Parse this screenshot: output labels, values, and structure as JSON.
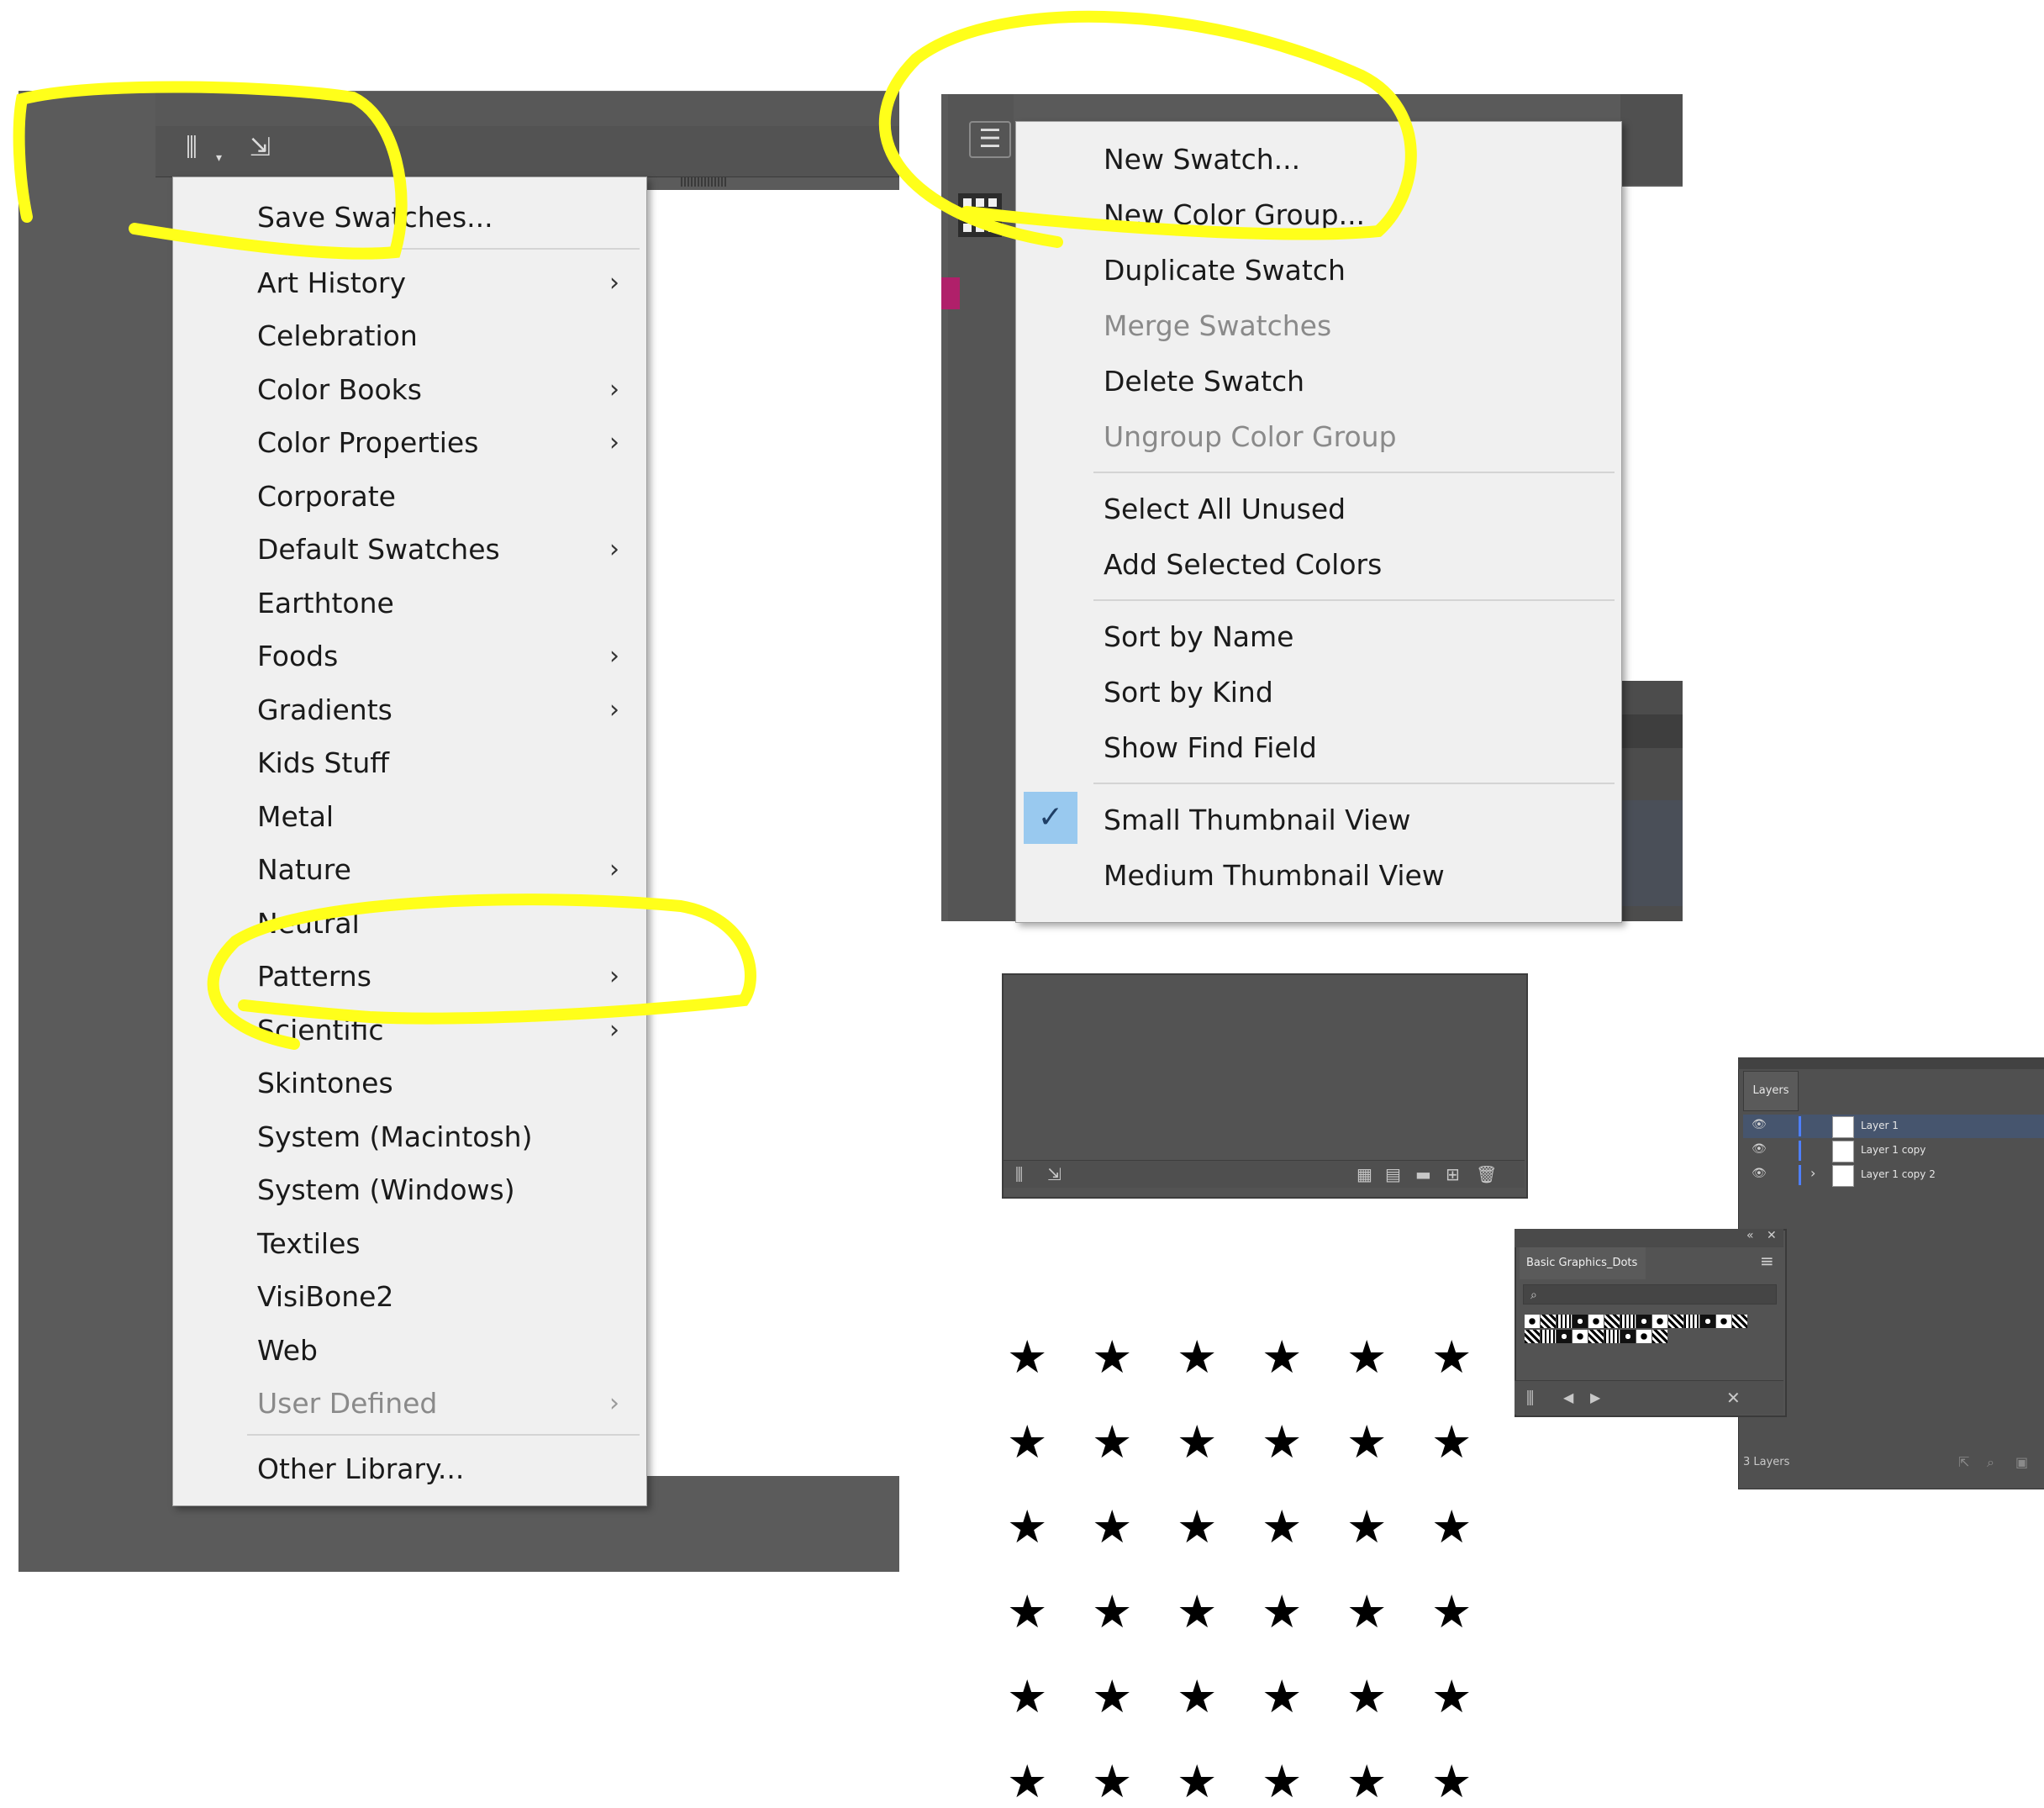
{
  "library_menu": {
    "items": [
      {
        "label": "Save Swatches...",
        "has_submenu": false,
        "disabled": false
      },
      {
        "label": "Art History",
        "has_submenu": true,
        "disabled": false
      },
      {
        "label": "Celebration",
        "has_submenu": false,
        "disabled": false
      },
      {
        "label": "Color Books",
        "has_submenu": true,
        "disabled": false
      },
      {
        "label": "Color Properties",
        "has_submenu": true,
        "disabled": false
      },
      {
        "label": "Corporate",
        "has_submenu": false,
        "disabled": false
      },
      {
        "label": "Default Swatches",
        "has_submenu": true,
        "disabled": false
      },
      {
        "label": "Earthtone",
        "has_submenu": false,
        "disabled": false
      },
      {
        "label": "Foods",
        "has_submenu": true,
        "disabled": false
      },
      {
        "label": "Gradients",
        "has_submenu": true,
        "disabled": false
      },
      {
        "label": "Kids Stuff",
        "has_submenu": false,
        "disabled": false
      },
      {
        "label": "Metal",
        "has_submenu": false,
        "disabled": false
      },
      {
        "label": "Nature",
        "has_submenu": true,
        "disabled": false
      },
      {
        "label": "Neutral",
        "has_submenu": false,
        "disabled": false
      },
      {
        "label": "Patterns",
        "has_submenu": true,
        "disabled": false
      },
      {
        "label": "Scientific",
        "has_submenu": true,
        "disabled": false
      },
      {
        "label": "Skintones",
        "has_submenu": false,
        "disabled": false
      },
      {
        "label": "System (Macintosh)",
        "has_submenu": false,
        "disabled": false
      },
      {
        "label": "System (Windows)",
        "has_submenu": false,
        "disabled": false
      },
      {
        "label": "Textiles",
        "has_submenu": false,
        "disabled": false
      },
      {
        "label": "VisiBone2",
        "has_submenu": false,
        "disabled": false
      },
      {
        "label": "Web",
        "has_submenu": false,
        "disabled": false
      },
      {
        "label": "User Defined",
        "has_submenu": true,
        "disabled": true
      },
      {
        "label": "Other Library...",
        "has_submenu": false,
        "disabled": false
      }
    ],
    "arrow_glyph": "›"
  },
  "panel_menu": {
    "items": [
      {
        "label": "New Swatch...",
        "disabled": false
      },
      {
        "label": "New Color Group...",
        "disabled": false
      },
      {
        "label": "Duplicate Swatch",
        "disabled": false
      },
      {
        "label": "Merge Swatches",
        "disabled": true
      },
      {
        "label": "Delete Swatch",
        "disabled": false
      },
      {
        "label": "Ungroup Color Group",
        "disabled": true
      },
      {
        "label": "Select All Unused",
        "disabled": false
      },
      {
        "label": "Add Selected Colors",
        "disabled": false
      },
      {
        "label": "Sort by Name",
        "disabled": false
      },
      {
        "label": "Sort by Kind",
        "disabled": false
      },
      {
        "label": "Show Find Field",
        "disabled": false
      },
      {
        "label": "Small Thumbnail View",
        "disabled": false,
        "checked": true
      },
      {
        "label": "Medium Thumbnail View",
        "disabled": false
      }
    ],
    "check_glyph": "✓",
    "hamburger_glyph": "☰"
  },
  "layers_panel": {
    "tab": "Layers",
    "layers": [
      {
        "name": "Layer 1",
        "selected": true
      },
      {
        "name": "Layer 1 copy",
        "selected": false
      },
      {
        "name": "Layer 1 copy 2",
        "selected": false
      }
    ],
    "footer": "3 Layers",
    "eye_glyph": "👁",
    "expand_glyph": "›"
  },
  "dots_panel": {
    "tab": "Basic Graphics_Dots",
    "search_glyph": "⌕",
    "prev_glyph": "◀",
    "next_glyph": "▶",
    "close_glyph": "✕",
    "menu_glyph": "≡",
    "collapse_glyph": "«"
  },
  "toolbar_icons": {
    "library": "⫼",
    "save": "⇲"
  },
  "stars": {
    "rows": 6,
    "cols": 6,
    "glyph": "★"
  },
  "colors": {
    "annotation": "#ffff1a",
    "menu_bg": "#f0f0f0",
    "panel_dark": "#535353",
    "check_highlight": "#99c9ef",
    "selection_blue": "#46556e"
  }
}
